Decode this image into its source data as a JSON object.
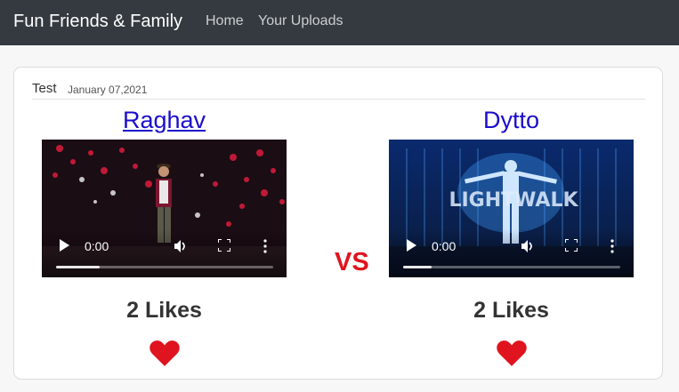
{
  "navbar": {
    "brand": "Fun Friends & Family",
    "links": [
      {
        "label": "Home"
      },
      {
        "label": "Your Uploads"
      }
    ]
  },
  "post": {
    "title": "Test",
    "date": "January 07,2021",
    "vs_label": "VS",
    "contestants": [
      {
        "name": "Raghav",
        "video": {
          "time": "0:00",
          "progress_fraction": 0.2
        },
        "likes_text": "2 Likes"
      },
      {
        "name": "Dytto",
        "video": {
          "time": "0:00",
          "progress_fraction": 0.13,
          "overlay_text": "LIGHTWALK"
        },
        "likes_text": "2 Likes"
      }
    ]
  },
  "colors": {
    "navbar_bg": "#343a40",
    "link_color": "#1a0dcc",
    "vs_color": "#e0141e",
    "heart_color": "#e0141e"
  }
}
